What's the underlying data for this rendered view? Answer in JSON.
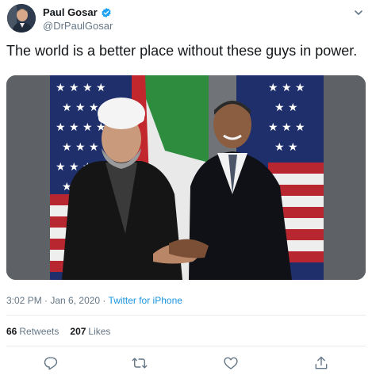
{
  "author": {
    "name": "Paul Gosar",
    "handle": "@DrPaulGosar",
    "verified": true
  },
  "tweet": {
    "text": "The world is a better place without these guys in power."
  },
  "meta": {
    "time": "3:02 PM",
    "separator": " · ",
    "date": "Jan 6, 2020",
    "source": "Twitter for iPhone"
  },
  "stats": {
    "retweets_count": "66",
    "retweets_label": "Retweets",
    "likes_count": "207",
    "likes_label": "Likes"
  },
  "actions": [
    {
      "icon": "reply-icon"
    },
    {
      "icon": "retweet-icon"
    },
    {
      "icon": "like-icon"
    },
    {
      "icon": "share-icon"
    }
  ],
  "colors": {
    "link": "#1b95e0",
    "secondary_text": "#657786",
    "primary_text": "#14171a",
    "verified": "#1da1f2"
  }
}
